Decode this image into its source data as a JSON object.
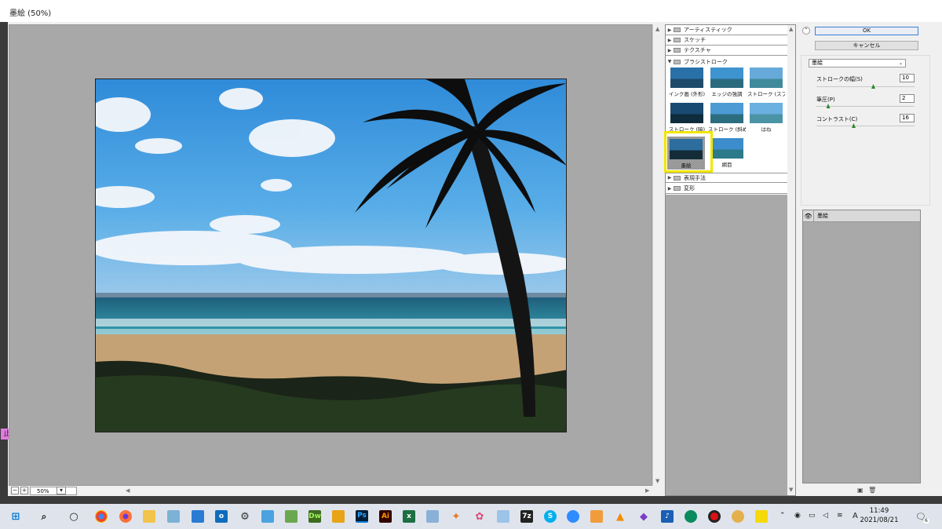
{
  "window": {
    "title": "墨絵 (50%)"
  },
  "preview": {
    "zoom": "50%"
  },
  "gallery": {
    "categories_top": [
      "アーティスティック",
      "スケッチ",
      "テクスチャ"
    ],
    "open_category": "ブラシストローク",
    "thumbnails": [
      "インク画 (外形)",
      "エッジの強調",
      "ストローク (スプレー)",
      "ストローク (暗)",
      "ストローク (斜め)",
      "はね",
      "墨絵",
      "網目"
    ],
    "selected": "墨絵",
    "categories_bottom": [
      "表現手法",
      "変形"
    ]
  },
  "buttons": {
    "ok": "OK",
    "cancel": "キャンセル"
  },
  "settings": {
    "filter": "墨絵",
    "params": [
      {
        "label": "ストロークの幅(S)",
        "value": "10",
        "level": 0.58
      },
      {
        "label": "筆圧(P)",
        "value": "2",
        "level": 0.12
      },
      {
        "label": "コントラスト(C)",
        "value": "16",
        "level": 0.38
      }
    ]
  },
  "layers": {
    "item": "墨絵"
  },
  "stamp": "止",
  "taskbar": {
    "apps": [
      "Dw",
      "Ps",
      "Ai"
    ],
    "ime": "A",
    "time": "11:49",
    "date": "2021/08/21",
    "notifications": "6"
  }
}
